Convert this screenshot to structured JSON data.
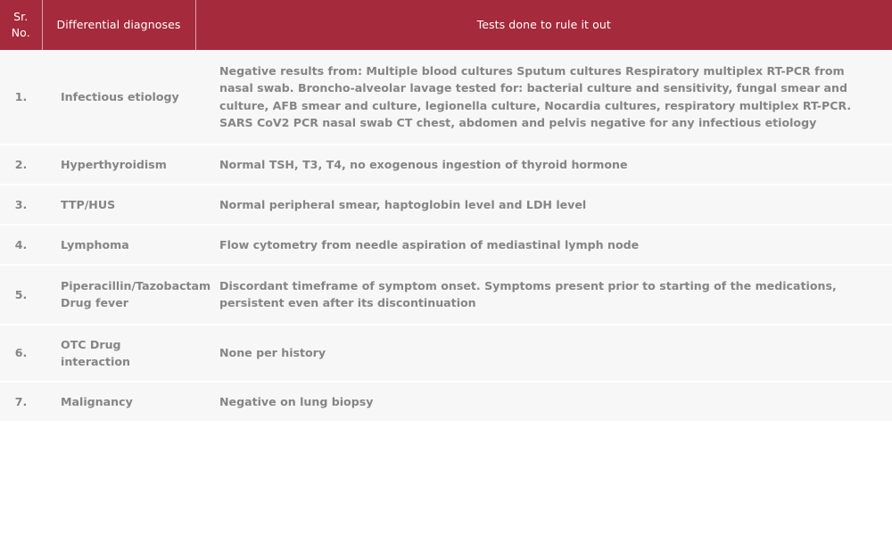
{
  "table": {
    "accent_color": "#a52a3b",
    "header_text_color": "#ffffff",
    "row_background": "#f7f7f7",
    "body_text_color": "#858585",
    "columns": [
      {
        "id": "sr",
        "label_line1": "Sr.",
        "label_line2": "No."
      },
      {
        "id": "diagnoses",
        "label": "Differential diagnoses"
      },
      {
        "id": "tests",
        "label": "Tests done to rule it out"
      }
    ],
    "rows": [
      {
        "sr": "1.",
        "diagnosis": "Infectious etiology",
        "tests": "Negative results from: Multiple blood cultures Sputum cultures Respiratory multiplex RT-PCR from nasal swab. Broncho-alveolar lavage tested for: bacterial culture and sensitivity, fungal smear and culture, AFB smear and culture, legionella culture, Nocardia cultures, respiratory multiplex RT-PCR. SARS CoV2 PCR nasal swab CT chest, abdomen and pelvis negative for any infectious etiology"
      },
      {
        "sr": "2.",
        "diagnosis": "Hyperthyroidism",
        "tests": "Normal TSH, T3, T4, no exogenous ingestion of thyroid hormone"
      },
      {
        "sr": "3.",
        "diagnosis": "TTP/HUS",
        "tests": "Normal peripheral smear, haptoglobin level and LDH level"
      },
      {
        "sr": "4.",
        "diagnosis": "Lymphoma",
        "tests": "Flow cytometry from needle aspiration of mediastinal lymph node"
      },
      {
        "sr": "5.",
        "diagnosis": "Piperacillin/Tazobactam Drug fever",
        "tests": "Discordant timeframe of symptom onset. Symptoms present prior to starting of the medications, persistent even after its discontinuation"
      },
      {
        "sr": "6.",
        "diagnosis": "OTC Drug interaction",
        "tests": "None per history"
      },
      {
        "sr": "7.",
        "diagnosis": "Malignancy",
        "tests": "Negative on lung biopsy"
      }
    ]
  }
}
